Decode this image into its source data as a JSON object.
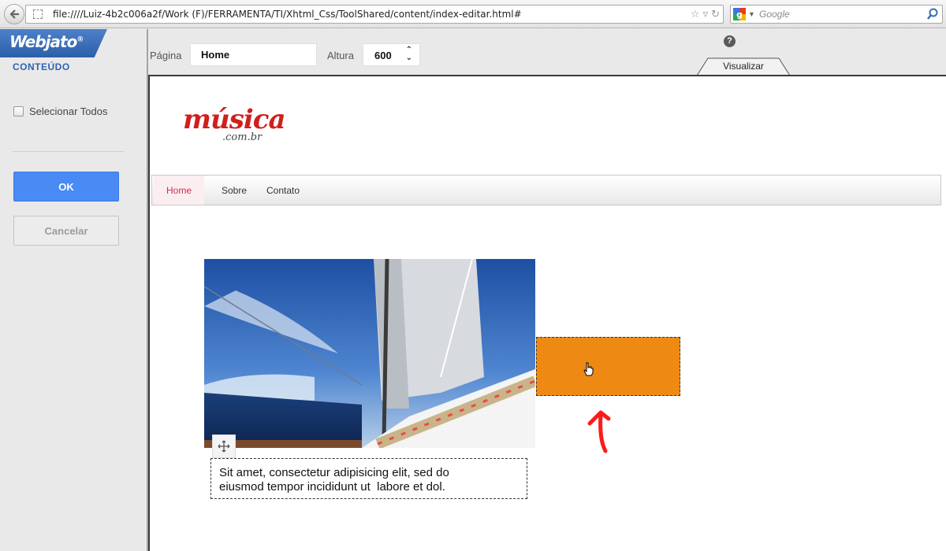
{
  "browser": {
    "url": "file:////Luiz-4b2c006a2f/Work  (F)/FERRAMENTA/TI/Xhtml_Css/ToolShared/content/index-editar.html#",
    "search_placeholder": "Google"
  },
  "sidebar": {
    "logo": "Webjato",
    "logo_mark": "®",
    "section_label": "CONTEÚDO",
    "select_all_label": "Selecionar Todos",
    "ok_label": "OK",
    "cancel_label": "Cancelar"
  },
  "toolbar": {
    "page_label": "Página",
    "page_value": "Home",
    "height_label": "Altura",
    "height_value": "600",
    "help_glyph": "?",
    "preview_tab": "Visualizar"
  },
  "site": {
    "logo_main": "música",
    "logo_sub": ".com.br",
    "nav": [
      "Home",
      "Sobre",
      "Contato"
    ],
    "body_text": "Sit amet, consectetur adipisicing elit, sed do\neiusmod tempor incididunt ut  labore et dol."
  },
  "colors": {
    "accent_blue": "#4a8af4",
    "logo_red": "#d0201c",
    "orange_block": "#ee8a13"
  }
}
